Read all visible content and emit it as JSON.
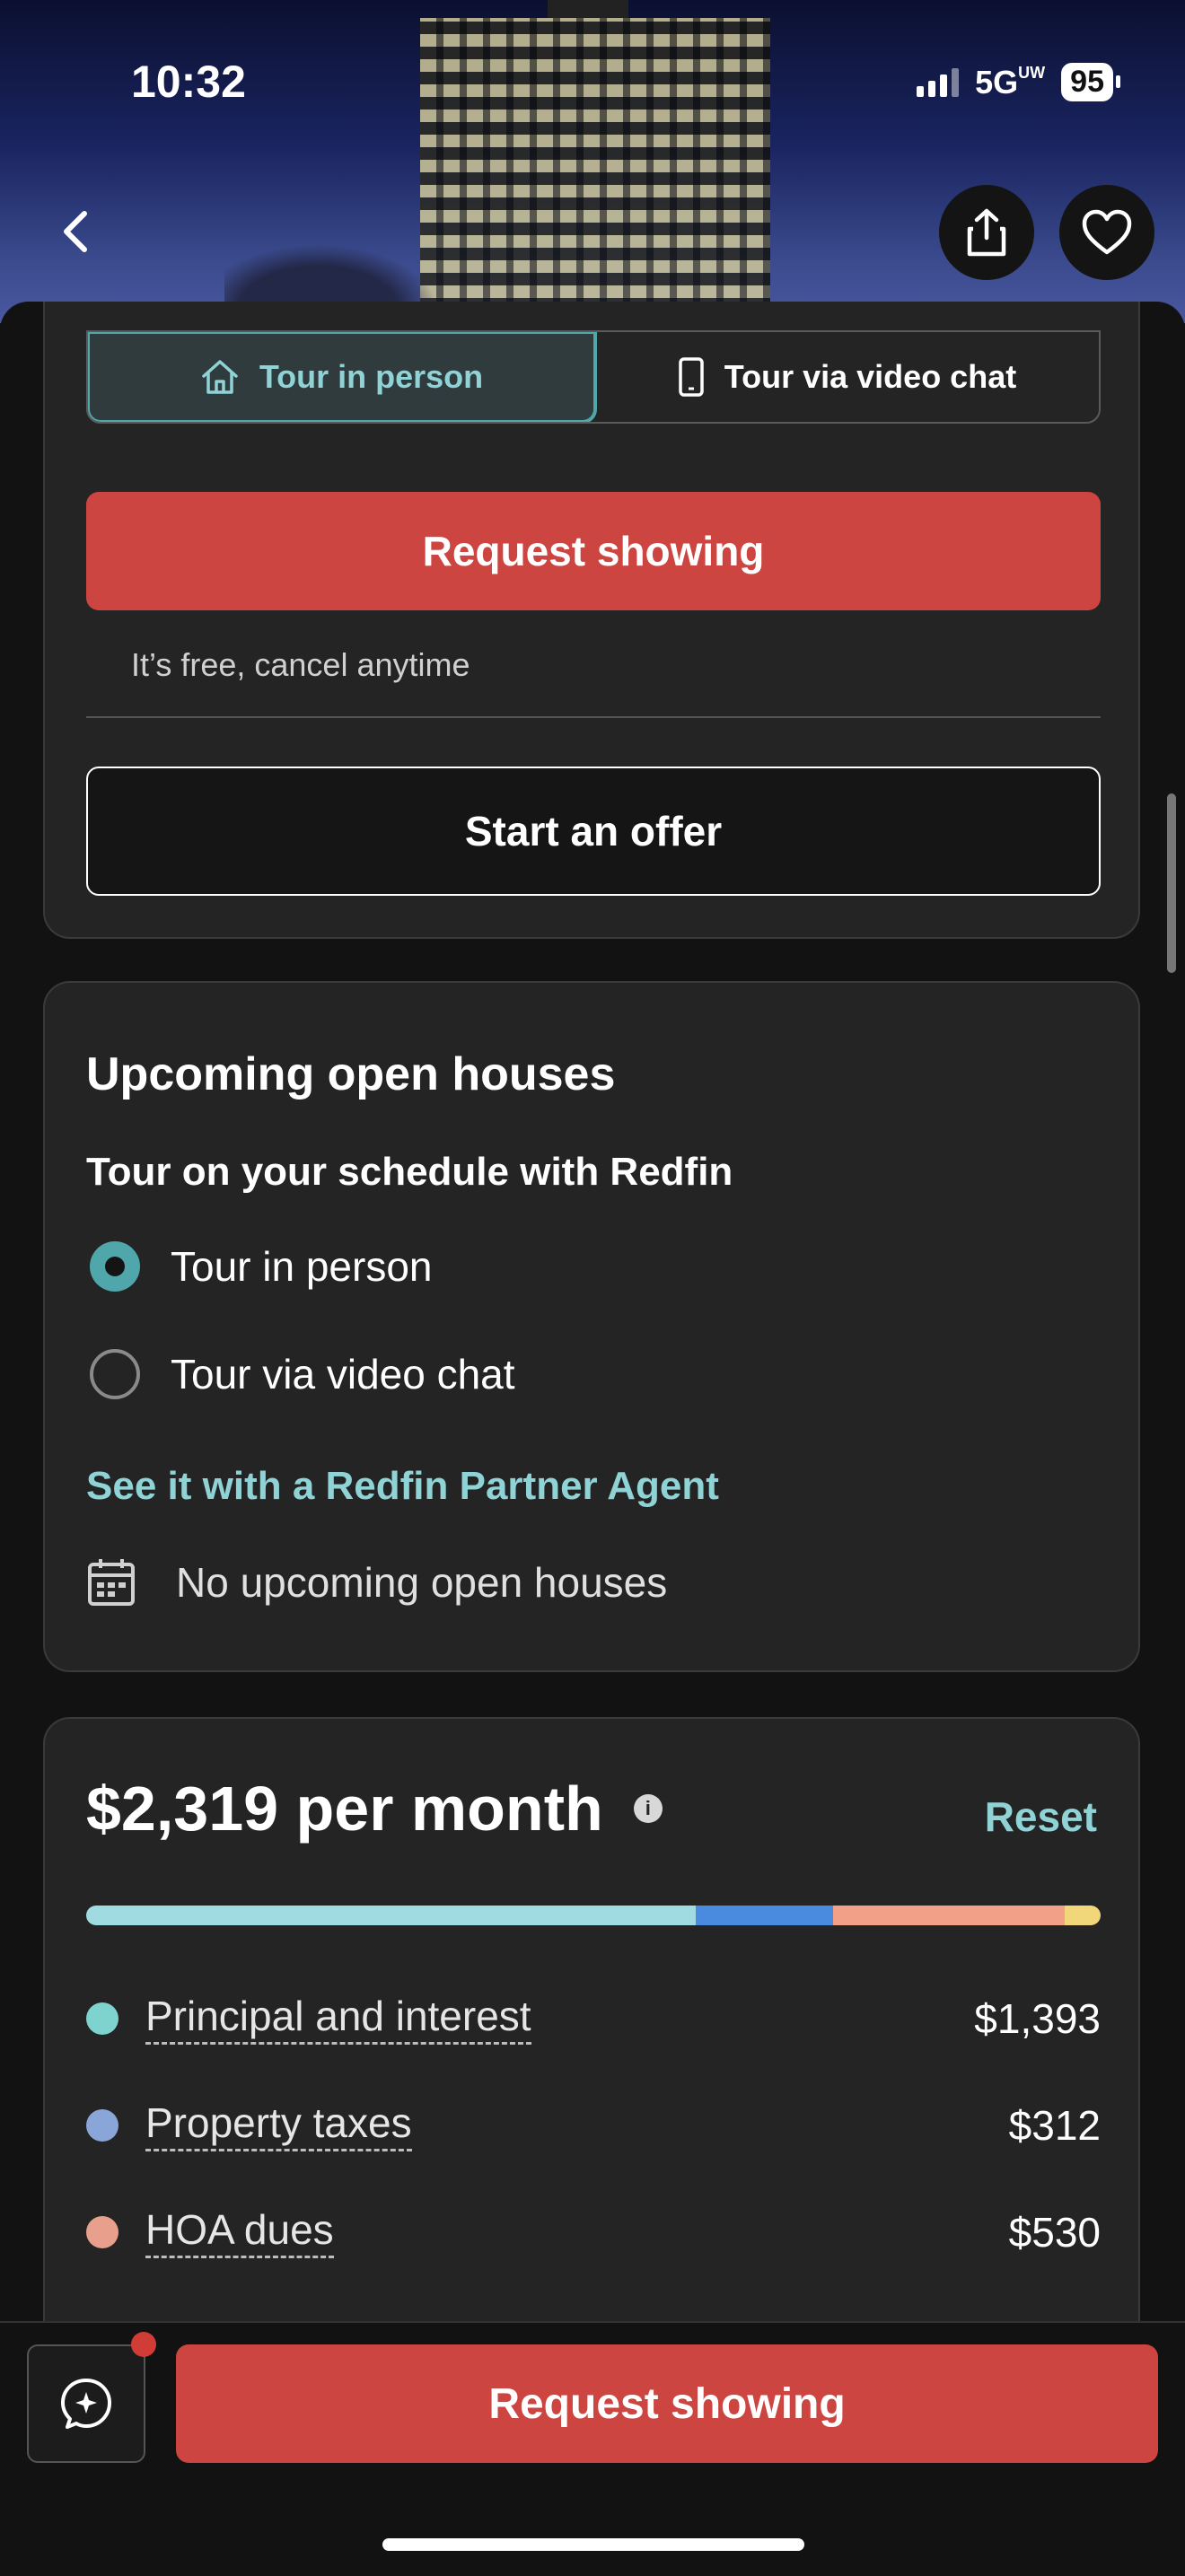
{
  "status_bar": {
    "time": "10:32",
    "network": "5G",
    "network_sup": "UW",
    "battery": "95"
  },
  "hero": {
    "back_icon": "chevron-left-icon",
    "share_icon": "share-icon",
    "favorite_icon": "heart-icon"
  },
  "tour_card": {
    "tabs": [
      {
        "label": "Tour in person",
        "icon": "house-icon",
        "active": true
      },
      {
        "label": "Tour via video chat",
        "icon": "phone-icon",
        "active": false
      }
    ],
    "request_label": "Request showing",
    "free_note": "It’s free, cancel anytime",
    "offer_label": "Start an offer"
  },
  "open_houses": {
    "title": "Upcoming open houses",
    "subtitle": "Tour on your schedule with Redfin",
    "options": [
      {
        "label": "Tour in person",
        "selected": true
      },
      {
        "label": "Tour via video chat",
        "selected": false
      }
    ],
    "partner_link": "See it with a Redfin Partner Agent",
    "no_open_houses": "No upcoming open houses"
  },
  "payment": {
    "title": "$2,319 per month",
    "reset_label": "Reset",
    "breakdown": [
      {
        "label": "Principal and interest",
        "value": "$1,393",
        "color": "#7fd3cf"
      },
      {
        "label": "Property taxes",
        "value": "$312",
        "color": "#8aa6d8"
      },
      {
        "label": "HOA dues",
        "value": "$530",
        "color": "#e8a08c"
      }
    ],
    "bar_segments": [
      {
        "color": "#9fdbe0",
        "share": 0.601
      },
      {
        "color": "#4a8be0",
        "share": 0.135
      },
      {
        "color": "#f2a088",
        "share": 0.229
      },
      {
        "color": "#f2d67a",
        "share": 0.035
      }
    ]
  },
  "bottom_bar": {
    "chat_icon": "chat-sparkle-icon",
    "request_label": "Request showing"
  },
  "colors": {
    "accent": "#8fd3d6",
    "cta": "#cc4540",
    "card_bg": "#242424",
    "page_bg": "#121212"
  }
}
